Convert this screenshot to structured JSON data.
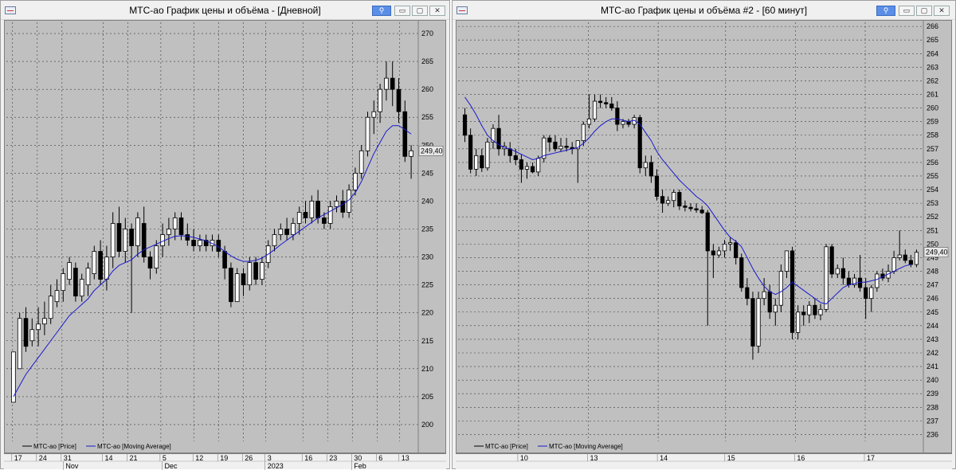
{
  "left": {
    "title": "МТС-ао График цены и объёма - [Дневной]",
    "price_label": "249,40",
    "legend": {
      "price": "МТС-ао [Price]",
      "ma": "МТС-ао [Moving Average]"
    },
    "x_days": [
      "17",
      "24",
      "31",
      "14",
      "21",
      "5",
      "12",
      "19",
      "26",
      "3",
      "16",
      "23",
      "30",
      "6",
      "13"
    ],
    "x_months": [
      "Nov",
      "Dec",
      "2023",
      "Feb"
    ],
    "colors": {
      "ma": "#1a1acc",
      "bg": "#c0c0c0",
      "grid": "#3a3a3a"
    },
    "chart_data": {
      "type": "candlestick",
      "ylim": [
        197,
        272
      ],
      "yticks": [
        200,
        205,
        210,
        215,
        220,
        225,
        230,
        235,
        240,
        245,
        250,
        255,
        260,
        265,
        270
      ],
      "candles": [
        [
          204,
          213,
          204,
          213
        ],
        [
          210,
          220,
          210,
          219
        ],
        [
          219,
          221,
          213,
          214
        ],
        [
          215,
          219,
          214,
          217
        ],
        [
          217,
          221,
          214,
          218
        ],
        [
          218,
          222,
          216,
          219
        ],
        [
          219,
          225,
          218,
          223
        ],
        [
          222,
          226,
          221,
          224
        ],
        [
          224,
          228,
          222,
          227
        ],
        [
          226,
          230,
          225,
          229
        ],
        [
          228,
          229,
          222,
          223
        ],
        [
          223,
          227,
          222,
          226
        ],
        [
          225,
          229,
          223,
          228
        ],
        [
          227,
          232,
          226,
          231
        ],
        [
          231,
          233,
          225,
          226
        ],
        [
          226,
          232,
          224,
          230
        ],
        [
          230,
          238,
          228,
          236
        ],
        [
          236,
          239,
          230,
          231
        ],
        [
          231,
          237,
          229,
          235
        ],
        [
          235,
          236,
          220,
          232
        ],
        [
          232,
          238,
          230,
          237
        ],
        [
          236,
          239,
          229,
          230
        ],
        [
          230,
          231,
          226,
          228
        ],
        [
          228,
          233,
          227,
          232
        ],
        [
          232,
          236,
          230,
          234
        ],
        [
          234,
          237,
          232,
          235
        ],
        [
          235,
          238,
          233,
          237
        ],
        [
          237,
          238,
          233,
          234
        ],
        [
          234,
          236,
          232,
          233
        ],
        [
          233,
          235,
          231,
          232
        ],
        [
          232,
          234,
          231,
          233
        ],
        [
          233,
          234,
          231,
          232
        ],
        [
          232,
          234,
          231,
          233
        ],
        [
          233,
          234,
          230,
          231
        ],
        [
          231,
          232,
          226,
          228
        ],
        [
          228,
          229,
          221,
          222
        ],
        [
          222,
          228,
          222,
          227
        ],
        [
          227,
          228,
          223,
          225
        ],
        [
          225,
          230,
          224,
          229
        ],
        [
          229,
          230,
          225,
          226
        ],
        [
          226,
          230,
          225,
          229
        ],
        [
          229,
          233,
          228,
          232
        ],
        [
          232,
          235,
          231,
          234
        ],
        [
          234,
          236,
          233,
          235
        ],
        [
          235,
          237,
          233,
          234
        ],
        [
          234,
          237,
          233,
          236
        ],
        [
          236,
          239,
          234,
          238
        ],
        [
          238,
          240,
          236,
          237
        ],
        [
          237,
          241,
          236,
          240
        ],
        [
          240,
          242,
          236,
          237
        ],
        [
          237,
          238,
          235,
          236
        ],
        [
          236,
          240,
          235,
          239
        ],
        [
          239,
          241,
          238,
          240
        ],
        [
          240,
          242,
          237,
          238
        ],
        [
          238,
          243,
          237,
          242
        ],
        [
          242,
          246,
          241,
          245
        ],
        [
          245,
          250,
          244,
          249
        ],
        [
          249,
          256,
          248,
          255
        ],
        [
          255,
          258,
          252,
          256
        ],
        [
          256,
          261,
          254,
          260
        ],
        [
          260,
          265,
          258,
          262
        ],
        [
          262,
          265,
          257,
          260
        ],
        [
          260,
          262,
          254,
          256
        ],
        [
          256,
          258,
          247,
          248
        ],
        [
          248,
          250,
          244,
          249
        ]
      ],
      "ma": [
        205,
        207,
        209,
        210.5,
        212,
        213.5,
        215,
        216.5,
        218,
        219.5,
        220.5,
        221.5,
        222.5,
        224,
        225,
        226,
        227.5,
        228.5,
        229,
        229.5,
        230.5,
        231.3,
        231.8,
        232.3,
        232.8,
        233.3,
        233.7,
        233.8,
        233.7,
        233.5,
        233.2,
        232.9,
        232.4,
        231.8,
        231,
        230.2,
        229.6,
        229.2,
        229.2,
        229.4,
        229.8,
        230.5,
        231.3,
        232.2,
        233,
        233.8,
        234.6,
        235.4,
        236.2,
        237,
        237.6,
        238.2,
        238.8,
        239.4,
        240.2,
        241.5,
        243.5,
        246,
        248.5,
        250.5,
        252.5,
        253.5,
        253.5,
        252.8,
        252
      ]
    }
  },
  "right": {
    "title": "МТС-ао График цены и объёма #2 - [60 минут]",
    "price_label": "249,40",
    "legend": {
      "price": "МТС-ао [Price]",
      "ma": "МТС-ао [Moving Average]"
    },
    "x_days": [
      "10",
      "13",
      "14",
      "15",
      "16",
      "17"
    ],
    "colors": {
      "ma": "#1a1acc",
      "bg": "#c0c0c0",
      "grid": "#3a3a3a"
    },
    "chart_data": {
      "type": "candlestick",
      "ylim": [
        235.5,
        266.3
      ],
      "yticks": [
        236,
        237,
        238,
        239,
        240,
        241,
        242,
        243,
        244,
        245,
        246,
        247,
        248,
        249,
        250,
        251,
        252,
        253,
        254,
        255,
        256,
        257,
        258,
        259,
        260,
        261,
        262,
        263,
        264,
        265,
        266
      ],
      "candles": [
        [
          259.5,
          260,
          257.5,
          258
        ],
        [
          258,
          258.5,
          255.2,
          255.5
        ],
        [
          255.5,
          257,
          255,
          256.5
        ],
        [
          256.5,
          257,
          255.3,
          255.6
        ],
        [
          255.6,
          257.8,
          255.4,
          257.5
        ],
        [
          257.5,
          258.8,
          257,
          258.5
        ],
        [
          258.5,
          259.5,
          256.5,
          257
        ],
        [
          257,
          257.5,
          256.5,
          257.2
        ],
        [
          257,
          257.5,
          256,
          256.5
        ],
        [
          256.5,
          257,
          255.8,
          256.2
        ],
        [
          256.2,
          256.6,
          254.5,
          255.5
        ],
        [
          255.5,
          256,
          254.8,
          255.7
        ],
        [
          255.7,
          256,
          255.2,
          255.3
        ],
        [
          255.3,
          256.5,
          255,
          256.3
        ],
        [
          256.3,
          258,
          256,
          257.8
        ],
        [
          257.8,
          258,
          256.8,
          257.5
        ],
        [
          257.5,
          258,
          256.8,
          257
        ],
        [
          257,
          257.8,
          256.8,
          257.2
        ],
        [
          257.2,
          257.8,
          256.8,
          257.1
        ],
        [
          257.1,
          257.5,
          256.6,
          257
        ],
        [
          257,
          257.5,
          254.5,
          257.6
        ],
        [
          257.6,
          259,
          257.2,
          258.8
        ],
        [
          258.8,
          261,
          258.5,
          259.2
        ],
        [
          259.2,
          261,
          259,
          260.5
        ],
        [
          260.5,
          261,
          260,
          260.4
        ],
        [
          260.4,
          260.8,
          260,
          260.3
        ],
        [
          260.3,
          260.8,
          259.8,
          260
        ],
        [
          260,
          260.5,
          258.3,
          258.8
        ],
        [
          258.8,
          259.2,
          258.5,
          259
        ],
        [
          259,
          259.2,
          258.6,
          258.8
        ],
        [
          258.8,
          259.5,
          258.5,
          259.3
        ],
        [
          259.3,
          259.5,
          255.2,
          255.6
        ],
        [
          255.6,
          256.5,
          255,
          256
        ],
        [
          256,
          256.5,
          254.5,
          255
        ],
        [
          255,
          255.5,
          253.2,
          253.5
        ],
        [
          253.5,
          254,
          252.3,
          253
        ],
        [
          253,
          253.5,
          252.8,
          253.2
        ],
        [
          253.2,
          254,
          252.7,
          253.8
        ],
        [
          253.8,
          254,
          252.5,
          252.8
        ],
        [
          252.8,
          253.2,
          252.4,
          252.7
        ],
        [
          252.7,
          253,
          252.4,
          252.6
        ],
        [
          252.6,
          253,
          252.3,
          252.5
        ],
        [
          252.5,
          252.8,
          252.2,
          252.3
        ],
        [
          252.3,
          252.5,
          244,
          249.5
        ],
        [
          249.5,
          250,
          247.5,
          249.2
        ],
        [
          249.2,
          249.8,
          249,
          249.5
        ],
        [
          249.5,
          250.3,
          249,
          250
        ],
        [
          250,
          250.5,
          249.5,
          250.1
        ],
        [
          250.1,
          250.3,
          248.5,
          249
        ],
        [
          249,
          249.3,
          246.5,
          246.8
        ],
        [
          246.8,
          247.5,
          245.5,
          246
        ],
        [
          246,
          246.5,
          241.5,
          242.5
        ],
        [
          242.5,
          246.5,
          242,
          246
        ],
        [
          246,
          247.5,
          245.5,
          246.5
        ],
        [
          246.5,
          247,
          244.5,
          245
        ],
        [
          245,
          246,
          244,
          245.5
        ],
        [
          245.5,
          248.5,
          245,
          248
        ],
        [
          248,
          249.5,
          247.5,
          249.5
        ],
        [
          249.5,
          249.8,
          243,
          243.5
        ],
        [
          243.5,
          245.5,
          243,
          245
        ],
        [
          245,
          245.5,
          244,
          244.8
        ],
        [
          244.8,
          245.8,
          244.2,
          245.5
        ],
        [
          245.5,
          246,
          244.5,
          244.8
        ],
        [
          244.8,
          245.6,
          244.4,
          245.2
        ],
        [
          245.2,
          250,
          245,
          249.8
        ],
        [
          249.8,
          250,
          247.5,
          247.8
        ],
        [
          247.8,
          248.5,
          247.5,
          248.2
        ],
        [
          248.2,
          249,
          247,
          247.5
        ],
        [
          247.5,
          248,
          246.8,
          247
        ],
        [
          247,
          247.8,
          246.8,
          247.5
        ],
        [
          247.5,
          249.2,
          246.5,
          246.8
        ],
        [
          246.8,
          247.5,
          244.5,
          246
        ],
        [
          246,
          247,
          245,
          246.8
        ],
        [
          246.8,
          248,
          246.5,
          247.8
        ],
        [
          247.8,
          248.2,
          247.3,
          247.5
        ],
        [
          247.5,
          248.5,
          247.2,
          248
        ],
        [
          248,
          249.5,
          247.8,
          249
        ],
        [
          249,
          251,
          248.8,
          249.2
        ],
        [
          249.2,
          249.6,
          248.6,
          248.8
        ],
        [
          248.8,
          249.2,
          248.3,
          248.5
        ],
        [
          248.5,
          249.6,
          248.3,
          249.4
        ]
      ],
      "ma": [
        260.8,
        260.2,
        259.5,
        258.7,
        258,
        257.6,
        257.3,
        257.1,
        257,
        256.8,
        256.6,
        256.4,
        256.2,
        256.3,
        256.5,
        256.6,
        256.7,
        256.8,
        256.9,
        257,
        257.1,
        257.4,
        257.8,
        258.3,
        258.7,
        259,
        259.2,
        259.2,
        259.1,
        259,
        259.1,
        258.8,
        258.2,
        257.6,
        256.8,
        256.2,
        255.7,
        255.2,
        254.7,
        254.3,
        253.9,
        253.5,
        253.2,
        252.8,
        252.2,
        251.6,
        251,
        250.5,
        250.2,
        249.8,
        249,
        248.2,
        247.5,
        246.9,
        246.5,
        246.3,
        246.5,
        246.8,
        247.2,
        246.9,
        246.6,
        246.3,
        246,
        245.7,
        245.6,
        246,
        246.4,
        246.8,
        247,
        247.1,
        247.2,
        247.2,
        247.3,
        247.4,
        247.6,
        247.8,
        248,
        248.2,
        248.4,
        248.5
      ]
    }
  }
}
